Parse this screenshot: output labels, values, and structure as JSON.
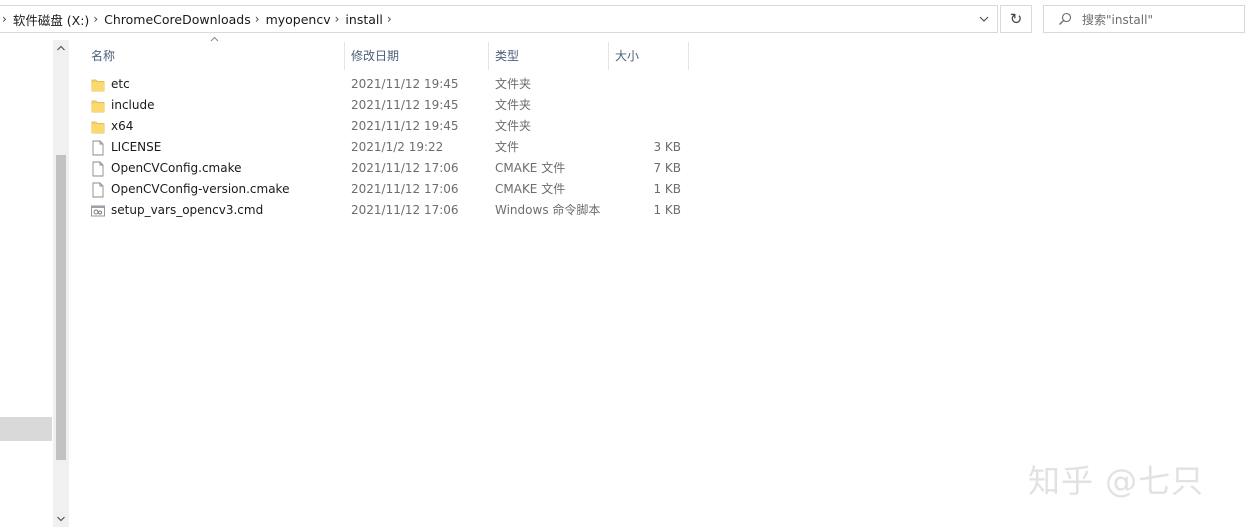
{
  "address_bar": {
    "path": [
      "软件磁盘 (X:)",
      "ChromeCoreDownloads",
      "myopencv",
      "install"
    ],
    "separator": "›"
  },
  "search": {
    "placeholder": "搜索\"install\""
  },
  "refresh_glyph": "↻",
  "columns": {
    "name": "名称",
    "date": "修改日期",
    "type": "类型",
    "size": "大小"
  },
  "files": [
    {
      "name": "etc",
      "date": "2021/11/12 19:45",
      "type": "文件夹",
      "size": "",
      "icon": "folder-icon"
    },
    {
      "name": "include",
      "date": "2021/11/12 19:45",
      "type": "文件夹",
      "size": "",
      "icon": "folder-icon"
    },
    {
      "name": "x64",
      "date": "2021/11/12 19:45",
      "type": "文件夹",
      "size": "",
      "icon": "folder-icon"
    },
    {
      "name": "LICENSE",
      "date": "2021/1/2 19:22",
      "type": "文件",
      "size": "3 KB",
      "icon": "file-icon"
    },
    {
      "name": "OpenCVConfig.cmake",
      "date": "2021/11/12 17:06",
      "type": "CMAKE 文件",
      "size": "7 KB",
      "icon": "file-icon"
    },
    {
      "name": "OpenCVConfig-version.cmake",
      "date": "2021/11/12 17:06",
      "type": "CMAKE 文件",
      "size": "1 KB",
      "icon": "file-icon"
    },
    {
      "name": "setup_vars_opencv3.cmd",
      "date": "2021/11/12 17:06",
      "type": "Windows 命令脚本",
      "size": "1 KB",
      "icon": "cmd-file-icon"
    }
  ],
  "watermark": "知乎 @七只",
  "colors": {
    "folder": "#f7d36b",
    "header_text": "#4c607a",
    "selection": "#d9d9d9"
  }
}
